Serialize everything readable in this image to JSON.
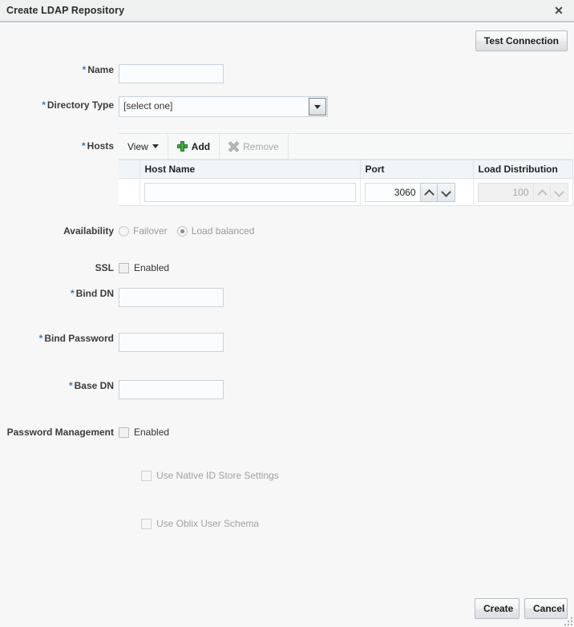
{
  "dialog": {
    "title": "Create LDAP Repository",
    "close_icon": "close-icon"
  },
  "toolbar": {
    "test_connection_label": "Test Connection"
  },
  "form": {
    "name": {
      "label": "Name",
      "required_marker": "*",
      "value": "",
      "placeholder": ""
    },
    "directory_type": {
      "label": "Directory Type",
      "required_marker": "*",
      "selected": "[select one]"
    },
    "hosts": {
      "label": "Hosts",
      "required_marker": "*",
      "toolbar": {
        "view_label": "View",
        "add_label": "Add",
        "remove_label": "Remove"
      },
      "columns": [
        "",
        "Host Name",
        "Port",
        "Load Distribution"
      ],
      "rows": [
        {
          "host_name": "",
          "port": "3060",
          "load_distribution": "100"
        }
      ]
    },
    "availability": {
      "label": "Availability",
      "options": [
        {
          "label": "Failover",
          "selected": false
        },
        {
          "label": "Load balanced",
          "selected": true
        }
      ]
    },
    "ssl": {
      "label": "SSL",
      "checkbox_label": "Enabled",
      "checked": false
    },
    "bind_dn": {
      "label": "Bind DN",
      "required_marker": "*",
      "value": ""
    },
    "bind_password": {
      "label": "Bind Password",
      "required_marker": "*",
      "value": ""
    },
    "base_dn": {
      "label": "Base DN",
      "required_marker": "*",
      "value": ""
    },
    "password_management": {
      "label": "Password Management",
      "checkbox_label": "Enabled",
      "checked": false
    },
    "use_native_id_store": {
      "checkbox_label": "Use Native ID Store Settings",
      "checked": false
    },
    "use_oblix_user_schema": {
      "checkbox_label": "Use Oblix User Schema",
      "checked": false
    }
  },
  "footer": {
    "create_label": "Create",
    "cancel_label": "Cancel"
  },
  "colors": {
    "required_marker": "#3a76c4",
    "header_bg": "#eff0f0",
    "body_bg": "#f7f7f7",
    "add_icon_green": "#3faf3f"
  }
}
